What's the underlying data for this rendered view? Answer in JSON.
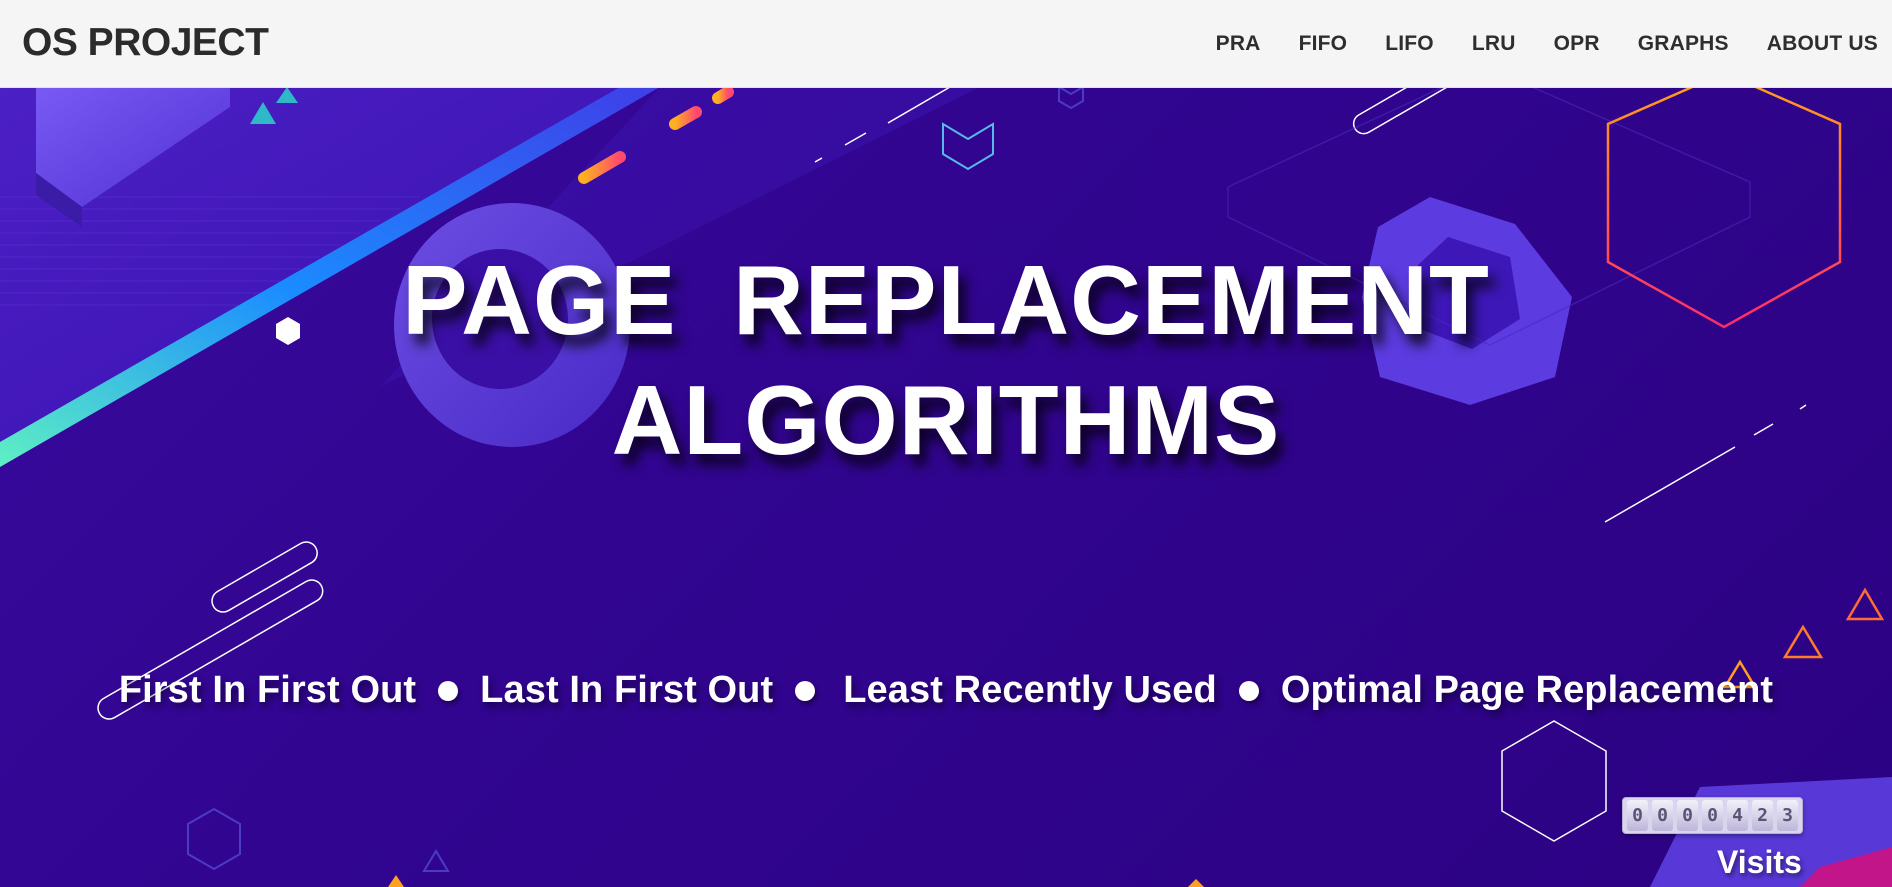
{
  "header": {
    "brand": "OS PROJECT",
    "nav": [
      {
        "label": "PRA"
      },
      {
        "label": "FIFO"
      },
      {
        "label": "LIFO"
      },
      {
        "label": "LRU"
      },
      {
        "label": "OPR"
      },
      {
        "label": "GRAPHS"
      },
      {
        "label": "ABOUT US"
      }
    ]
  },
  "hero": {
    "title_line1": "PAGE  REPLACEMENT",
    "title_line2": "ALGORITHMS",
    "algorithms": [
      "First In First Out",
      "Last In First Out",
      "Least Recently Used",
      "Optimal Page Replacement"
    ]
  },
  "visit_counter": {
    "digits": [
      "0",
      "0",
      "0",
      "0",
      "4",
      "2",
      "3"
    ],
    "label": "Visits"
  },
  "colors": {
    "background": "#2f0388",
    "navbar": "#f5f5f5",
    "accent_orange": "#ff9a1f",
    "accent_red": "#ff2d55",
    "accent_teal": "#39d3c6",
    "shape_violet": "#6a4de0"
  }
}
